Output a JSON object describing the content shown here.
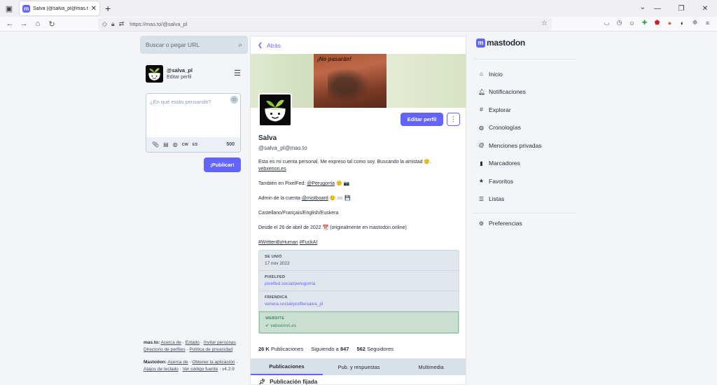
{
  "browser": {
    "tab_title": "Salva (@salva_pl@mas.to) - ma...",
    "url": "https://mas.to/@salva_pl"
  },
  "left": {
    "search_placeholder": "Buscar o pegar URL",
    "me_handle": "@salva_pl",
    "me_edit": "Editar perfil",
    "compose_placeholder": "¿En qué estás pensando?",
    "cw": "CW",
    "lang": "ES",
    "char_count": "500",
    "publish_label": "¡Publicar!",
    "footer": {
      "site_prefix": "mas.to:",
      "about": "Acerca de",
      "status": "Estado",
      "invite": "Invitar personas",
      "directory": "Directorio de perfiles",
      "privacy": "Política de privacidad",
      "mastodon_prefix": "Mastodon:",
      "m_about": "Acerca de",
      "get_app": "Obtener la aplicación",
      "shortcuts": "Atajos de teclado",
      "source": "Ver código fuente",
      "version": "v4.2.9"
    }
  },
  "profile": {
    "back_label": "Atrás",
    "banner_text": "¡No pasarán!",
    "edit_label": "Editar perfil",
    "display_name": "Salva",
    "acct": "@salva_pl@mas.to",
    "bio": {
      "line1": "Esta es mi cuenta personal. Me expreso tal como soy. Buscando la amistad 🙂.",
      "line1_link": "vebxenon.es",
      "line2_pre": "También en PixelFed: ",
      "line2_link": "@Perugorria",
      "line2_post": " 🙂 📷",
      "line3_pre": "Admin de la cuenta ",
      "line3_link": "@mistboard",
      "line3_post": " 🙂 ⌨️ 💾",
      "line4": "Castellano/Français/English/Euskera",
      "line5": "Desde el 26 de abril de 2022 📆 (originalmente en mastodon.online)",
      "hashtag1": "#WrittenByHuman",
      "hashtag2": "#FuckAI"
    },
    "fields": [
      {
        "key": "SE UNIÓ",
        "value": "17 nov 2022"
      },
      {
        "key": "PIXELFED",
        "value": "pixelfed.social/perugorria"
      },
      {
        "key": "FRIENDICA",
        "value": "venera.social/profile/salva_pl"
      },
      {
        "key": "WEBSITE",
        "value": "vebxenon.es"
      }
    ],
    "stats": {
      "posts_num": "26 K",
      "posts_label": "Publicaciones",
      "following_label": "Siguiendo a",
      "following_num": "847",
      "followers_num": "562",
      "followers_label": "Seguidores"
    },
    "tabs": [
      "Publicaciones",
      "Pub. y respuestas",
      "Multimedia"
    ],
    "pinned_label": "Publicación fijada"
  },
  "nav": {
    "logo": "mastodon",
    "items": [
      "Inicio",
      "Notificaciones",
      "Explorar",
      "Cronologías",
      "Menciones privadas",
      "Marcadores",
      "Favoritos",
      "Listas"
    ],
    "preferences": "Preferencias"
  },
  "colors": {
    "accent": "#6364ff",
    "verified": "#3a8a5a"
  }
}
